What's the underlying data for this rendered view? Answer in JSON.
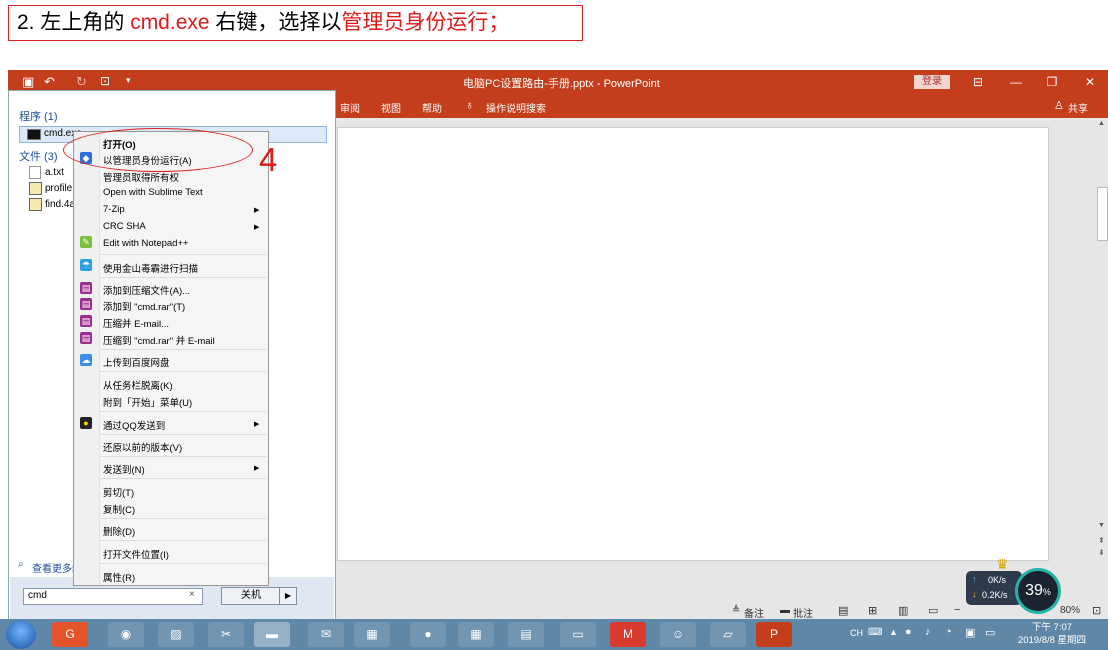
{
  "instruction": {
    "prefix": "2. 左上角的 ",
    "cmd_name": "cmd.exe",
    "middle": " 右键，选择以",
    "action": "管理员身份运行；"
  },
  "powerpoint": {
    "window_title": "电脑PC设置路由-手册.pptx  -  PowerPoint",
    "login_label": "登录",
    "ribbon_tabs": [
      "审阅",
      "视图",
      "帮助"
    ],
    "tell_me": "操作说明搜索",
    "share_label": "共享",
    "status": {
      "notes": "备注",
      "comments": "批注",
      "zoom": "80%"
    }
  },
  "start_menu": {
    "programs_header": "程序 (1)",
    "program_item": "cmd.exe",
    "files_header": "文件 (3)",
    "files": [
      "a.txt",
      "profile",
      "find.4a"
    ],
    "see_more": "查看更多结果",
    "search_value": "cmd",
    "shutdown_label": "关机"
  },
  "context_menu": {
    "items": [
      {
        "label": "打开(O)",
        "bold": true
      },
      {
        "label": "以管理员身份运行(A)"
      },
      {
        "label": "管理员取得所有权"
      },
      {
        "label": "Open with Sublime Text"
      },
      {
        "label": "7-Zip",
        "submenu": true
      },
      {
        "label": "CRC SHA",
        "submenu": true
      },
      {
        "label": "Edit with Notepad++"
      },
      {
        "label": "使用金山毒霸进行扫描"
      },
      {
        "label": "添加到压缩文件(A)..."
      },
      {
        "label": "添加到 \"cmd.rar\"(T)"
      },
      {
        "label": "压缩并 E-mail..."
      },
      {
        "label": "压缩到 \"cmd.rar\" 并 E-mail"
      },
      {
        "label": "上传到百度网盘"
      },
      {
        "label": "从任务栏脱离(K)"
      },
      {
        "label": "附到「开始」菜单(U)"
      },
      {
        "label": "通过QQ发送到",
        "submenu": true
      },
      {
        "label": "还原以前的版本(V)"
      },
      {
        "label": "发送到(N)",
        "submenu": true
      },
      {
        "label": "剪切(T)"
      },
      {
        "label": "复制(C)"
      },
      {
        "label": "删除(D)"
      },
      {
        "label": "打开文件位置(I)"
      },
      {
        "label": "属性(R)"
      }
    ]
  },
  "annotation_step": "4",
  "network_widget": {
    "up": "0K/s",
    "down": "0.2K/s",
    "percent": "39",
    "percent_sign": "%"
  },
  "taskbar": {
    "lang": "CH",
    "time": "下午 7:07",
    "date": "2019/8/8 星期四"
  },
  "colors": {
    "ppt_accent": "#c43e1c",
    "highlight_red": "#e01818",
    "taskbar": "#5f87a8"
  }
}
